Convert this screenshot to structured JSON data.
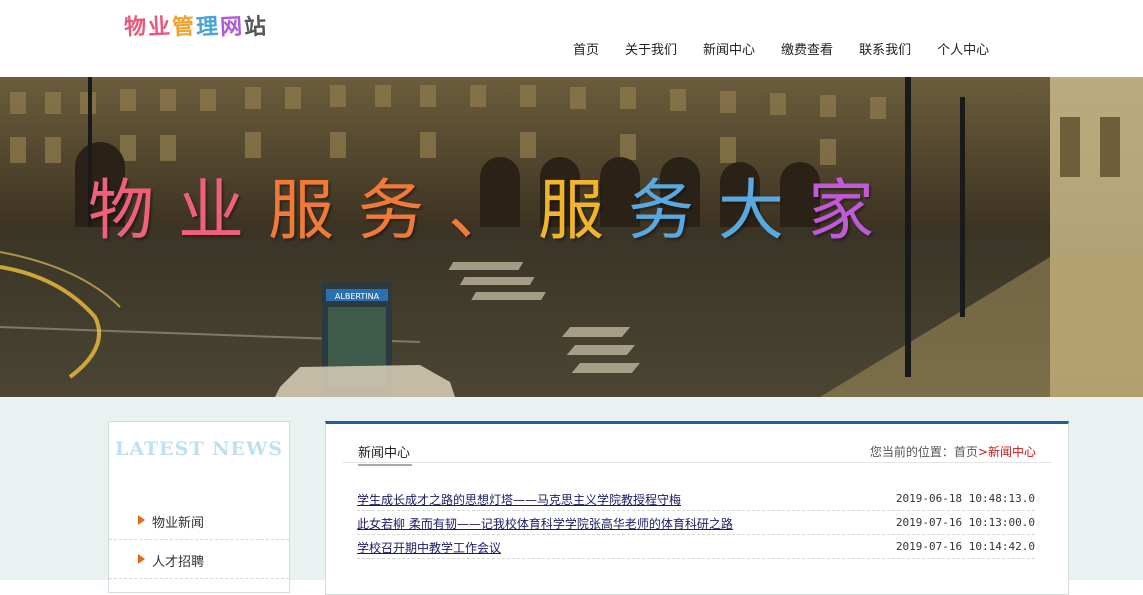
{
  "header": {
    "logo_chars": [
      {
        "ch": "物",
        "color": "#e8587a"
      },
      {
        "ch": "业",
        "color": "#e8587a"
      },
      {
        "ch": "管",
        "color": "#f0a32b"
      },
      {
        "ch": "理",
        "color": "#4aa3d8"
      },
      {
        "ch": "网",
        "color": "#b05bd6"
      },
      {
        "ch": "站",
        "color": "#555555"
      }
    ],
    "nav": [
      "首页",
      "关于我们",
      "新闻中心",
      "缴费查看",
      "联系我们",
      "个人中心"
    ]
  },
  "banner": {
    "slogan_chars": [
      {
        "ch": "物",
        "color": "#f0607a"
      },
      {
        "ch": "业",
        "color": "#f0607a"
      },
      {
        "ch": "服",
        "color": "#f07a3a"
      },
      {
        "ch": "务",
        "color": "#f07a3a"
      },
      {
        "ch": "、",
        "color": "#f07a3a"
      },
      {
        "ch": "服",
        "color": "#f0b52c"
      },
      {
        "ch": "务",
        "color": "#5aa8e0"
      },
      {
        "ch": "大",
        "color": "#5aa8e0"
      },
      {
        "ch": "家",
        "color": "#c05ad8"
      }
    ],
    "sign_text": "ALBERTINA"
  },
  "sidebar": {
    "title": "LATEST NEWS",
    "items": [
      "物业新闻",
      "人才招聘"
    ]
  },
  "main": {
    "title": "新闻中心",
    "breadcrumb": {
      "prefix": "您当前的位置：",
      "home": "首页",
      "sep": ">",
      "current": "新闻中心"
    },
    "news": [
      {
        "title": "学生成长成才之路的思想灯塔——马克思主义学院教授程守梅",
        "date": "2019-06-18 10:48:13.0"
      },
      {
        "title": "此女若柳 柔而有韧——记我校体育科学学院张高华老师的体育科研之路",
        "date": "2019-07-16 10:13:00.0"
      },
      {
        "title": "学校召开期中教学工作会议",
        "date": "2019-07-16 10:14:42.0"
      }
    ]
  }
}
